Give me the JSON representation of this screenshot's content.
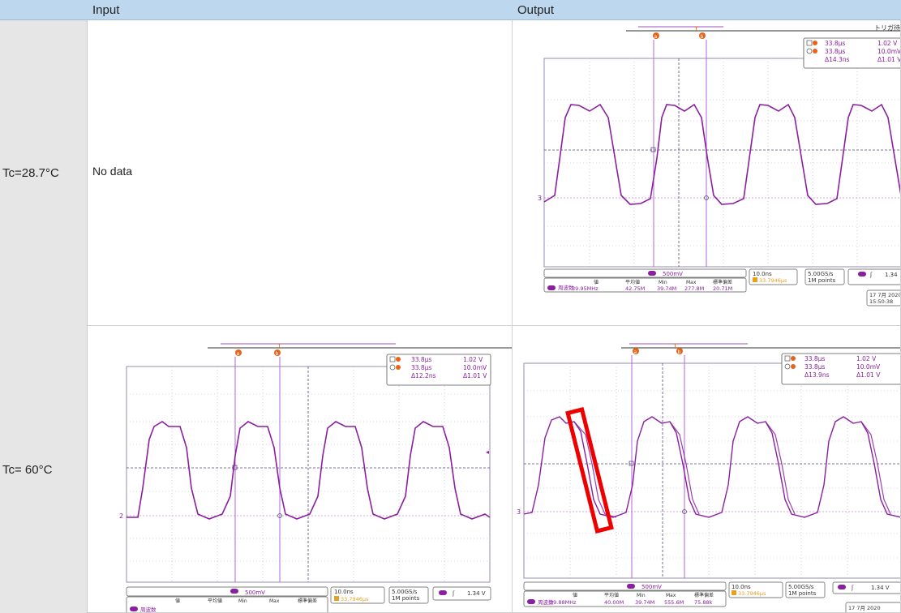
{
  "header": {
    "corner": "",
    "input": "Input",
    "output": "Output"
  },
  "rows": [
    {
      "label": "Tc=28.7°C",
      "input_text": "No data"
    },
    {
      "label": "Tc= 60°C"
    }
  ],
  "scopes": {
    "out1": {
      "top_note": "トリガ待ち",
      "cursor_a_t": "33.8μs",
      "cursor_a_v": "1.02 V",
      "cursor_b_t": "33.8μs",
      "cursor_b_v": "10.0mV",
      "delta_t": "Δ14.3ns",
      "delta_v": "Δ1.01 V",
      "scale": "500mV",
      "timebase": "10.0ns",
      "trigger_pos": "33.7946μs",
      "rate": "5.00GS/s",
      "points": "1M points",
      "trig_level": "1.34",
      "meas_label": "周波数",
      "col_val": "値",
      "col_mean": "平均値",
      "col_min": "Min",
      "col_max": "Max",
      "col_std": "標準偏差",
      "val": "39.95MHz",
      "mean": "42.75M",
      "min": "39.74M",
      "max": "277.8M",
      "std": "20.71M",
      "date": "17 7月 2020",
      "time": "15:50:38"
    },
    "in2": {
      "cursor_a_t": "33.8μs",
      "cursor_a_v": "1.02 V",
      "cursor_b_t": "33.8μs",
      "cursor_b_v": "10.0mV",
      "delta_t": "Δ12.2ns",
      "delta_v": "Δ1.01 V",
      "scale": "500mV",
      "timebase": "10.0ns",
      "trigger_pos": "33.7946μs",
      "rate": "5.00GS/s",
      "points": "1M points",
      "trig_level": "1.34 V",
      "meas_label": "周波数",
      "col_val": "値",
      "col_mean": "平均値",
      "col_min": "Min",
      "col_max": "Max",
      "col_std": "標準偏差"
    },
    "out2": {
      "cursor_a_t": "33.8μs",
      "cursor_a_v": "1.02 V",
      "cursor_b_t": "33.8μs",
      "cursor_b_v": "10.0mV",
      "delta_t": "Δ13.9ns",
      "delta_v": "Δ1.01 V",
      "scale": "500mV",
      "timebase": "10.0ns",
      "trigger_pos": "33.7946μs",
      "rate": "5.00GS/s",
      "points": "1M points",
      "trig_level": "1.34 V",
      "meas_label": "周波数",
      "col_val": "値",
      "col_mean": "平均値",
      "col_min": "Min",
      "col_max": "Max",
      "col_std": "標準偏差",
      "val": "39.88MHz",
      "mean": "40.00M",
      "min": "39.74M",
      "max": "555.6M",
      "std": "75.88k",
      "date": "17 7月 2020"
    }
  },
  "colors": {
    "trace": "#8a1fa0",
    "cursor": "#b266d6",
    "marker": "#e8631a",
    "highlight": "#ee0000",
    "grid": "#5a4a7a",
    "header": "#bdd7ee"
  }
}
